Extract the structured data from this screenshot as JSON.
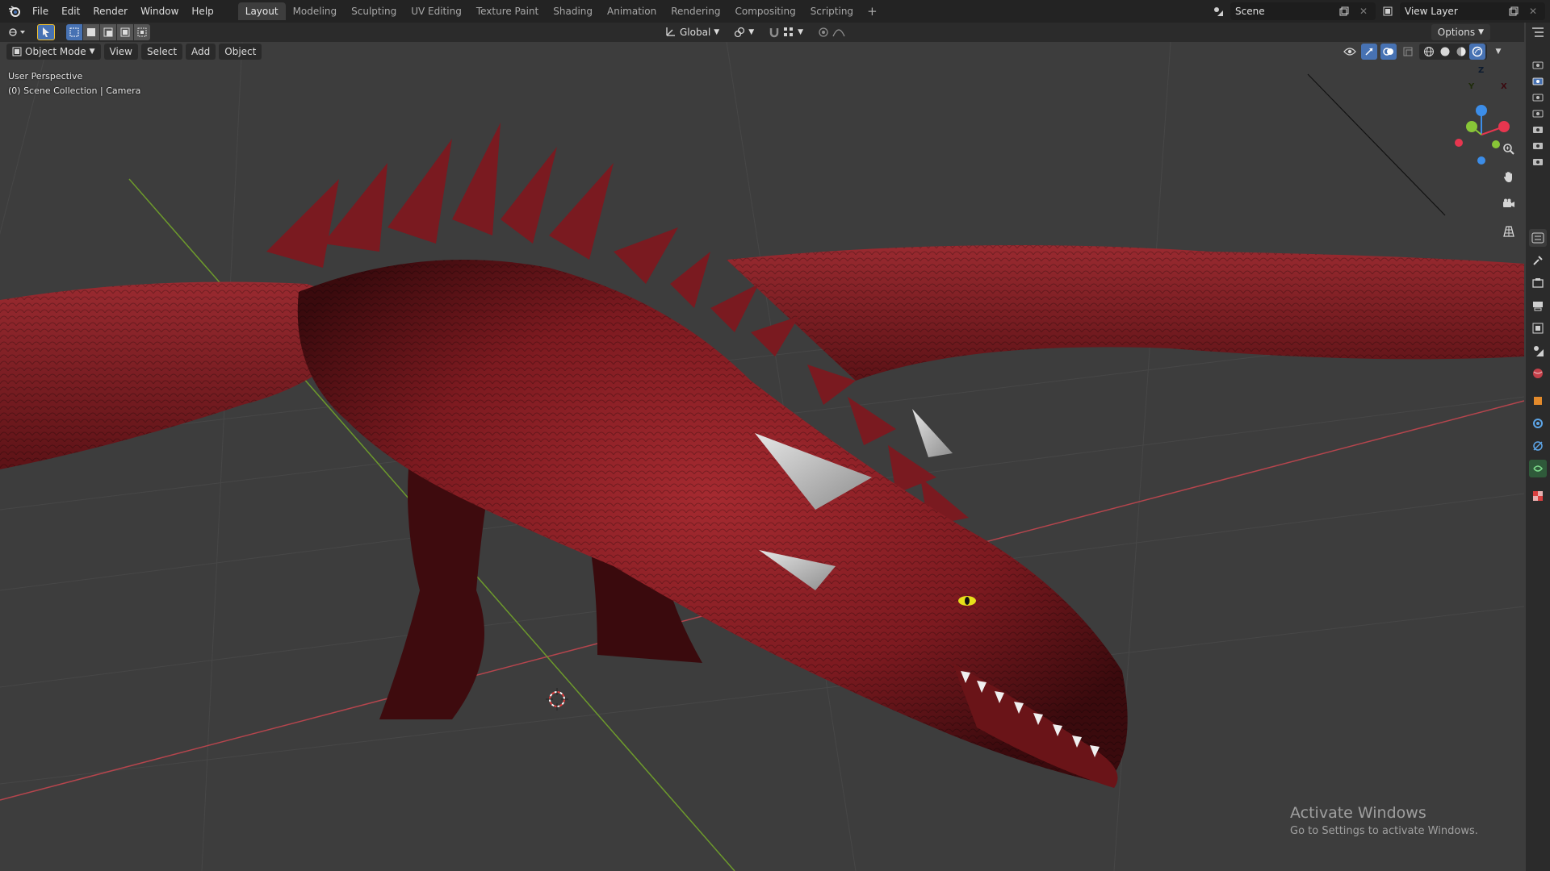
{
  "menu": {
    "items": [
      "File",
      "Edit",
      "Render",
      "Window",
      "Help"
    ]
  },
  "workspaces": {
    "tabs": [
      "Layout",
      "Modeling",
      "Sculpting",
      "UV Editing",
      "Texture Paint",
      "Shading",
      "Animation",
      "Rendering",
      "Compositing",
      "Scripting"
    ],
    "active": "Layout",
    "add_label": "+"
  },
  "scene": {
    "name": "Scene",
    "view_layer": "View Layer"
  },
  "tool_header": {
    "transform_orientation": "Global",
    "options_label": "Options"
  },
  "viewport_header": {
    "mode": "Object Mode",
    "view": "View",
    "select": "Select",
    "add": "Add",
    "object": "Object"
  },
  "viewport": {
    "perspective_label": "User Perspective",
    "collection_label": "(0) Scene Collection | Camera",
    "subject": "red dragon model",
    "gizmo": {
      "x_label": "X",
      "y_label": "Y",
      "z_label": "Z",
      "x_color": "#e7364f",
      "y_color": "#88c637",
      "z_color": "#3c8de8"
    }
  },
  "colors": {
    "accent": "#4772b3",
    "x_axis_line": "#b5454d",
    "y_axis_line": "#6d9a2c",
    "dragon_red": "#8a1c22",
    "viewport_bg": "#3d3d3d"
  },
  "watermark": {
    "title": "Activate Windows",
    "subtitle": "Go to Settings to activate Windows."
  }
}
